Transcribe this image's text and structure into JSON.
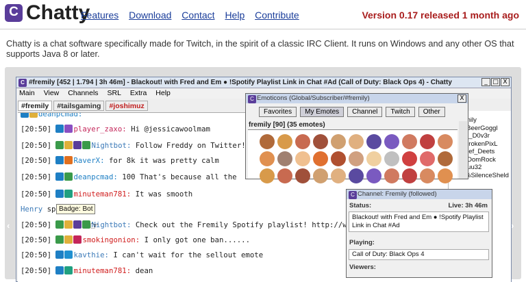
{
  "header": {
    "logo_glyph": "C",
    "brand": "Chatty",
    "nav": [
      "Features",
      "Download",
      "Contact",
      "Help",
      "Contribute"
    ],
    "version": "Version 0.17 released 1 month ago"
  },
  "intro": "Chatty is a chat software specifically made for Twitch, in the spirit of a classic IRC Client. It runs on Windows and any other OS that supports Java 8 or later.",
  "colors": {
    "accent": "#5a3d9a",
    "link": "#1a3d9a",
    "version": "#a81c1c"
  },
  "window": {
    "title": "#fremily [452 | 1.794 | 3h 46m] - Blackout! with Fred and Em ● !Spotify Playlist Link in Chat #Ad (Call of Duty: Black Ops 4) - Chatty",
    "controls": [
      "_",
      "□",
      "X"
    ],
    "menu": [
      "Main",
      "View",
      "Channels",
      "SRL",
      "Extra",
      "Help"
    ],
    "tabs": [
      "#fremily",
      "#tailsgaming",
      "#joshimuz"
    ]
  },
  "chat": [
    {
      "time": "",
      "user": "deanpcmad:",
      "color": "#1e7fc4",
      "text": ""
    },
    {
      "time": "[20:50]",
      "user": "player_zaxo:",
      "color": "#c4265a",
      "text": "Hi @jessicawoolmam"
    },
    {
      "time": "[20:50]",
      "user": "Nightbot:",
      "color": "#3c7ab8",
      "text": "Follow Freddy on Twitter!"
    },
    {
      "time": "[20:50]",
      "user": "RaverX:",
      "color": "#1e7fc4",
      "text": "for 8k it was pretty calm"
    },
    {
      "time": "[20:50]",
      "user": "deanpcmad:",
      "color": "#1e7fc4",
      "text": "100 That's because all the"
    },
    {
      "time": "[20:50]",
      "user": "minuteman781:",
      "color": "#d01c1c",
      "text": "It was smooth"
    },
    {
      "time": "",
      "user": "Henry",
      "color": "#3c7ab8",
      "text": "spotify"
    },
    {
      "time": "[20:50]",
      "user": "Nightbot:",
      "color": "#3c7ab8",
      "text": "Check out the Fremily Spotify playlist! http://www"
    },
    {
      "time": "[20:50]",
      "user": "smokingonion:",
      "color": "#d01c1c",
      "text": "I only got one ban......"
    },
    {
      "time": "[20:50]",
      "user": "kavthie:",
      "color": "#3c7ab8",
      "text": "I can't wait for the sellout emote"
    },
    {
      "time": "[20:50]",
      "user": "minuteman781:",
      "color": "#d01c1c",
      "text": "dean"
    }
  ],
  "tooltip": "Badge: Bot",
  "emoticons": {
    "title": "Emoticons (Global/Subscriber/#fremily)",
    "tabs": [
      "Favorites",
      "My Emotes",
      "Channel",
      "Twitch",
      "Other"
    ],
    "header": "fremily [90] (35 emotes)"
  },
  "userlist": [
    "mily",
    "lBeerGoggl",
    "n_D0v3r",
    "brokenPixL",
    "hef_Deets",
    "rDomRock",
    "ruu32",
    "%SilenceSheld"
  ],
  "channel": {
    "title": "Channel: Fremily (followed)",
    "status_label": "Status:",
    "live": "Live: 3h 46m",
    "status": "Blackout! with Fred and Em ● !Spotify Playlist Link in Chat #Ad",
    "playing_label": "Playing:",
    "playing": "Call of Duty: Black Ops 4",
    "viewers_label": "Viewers:"
  }
}
